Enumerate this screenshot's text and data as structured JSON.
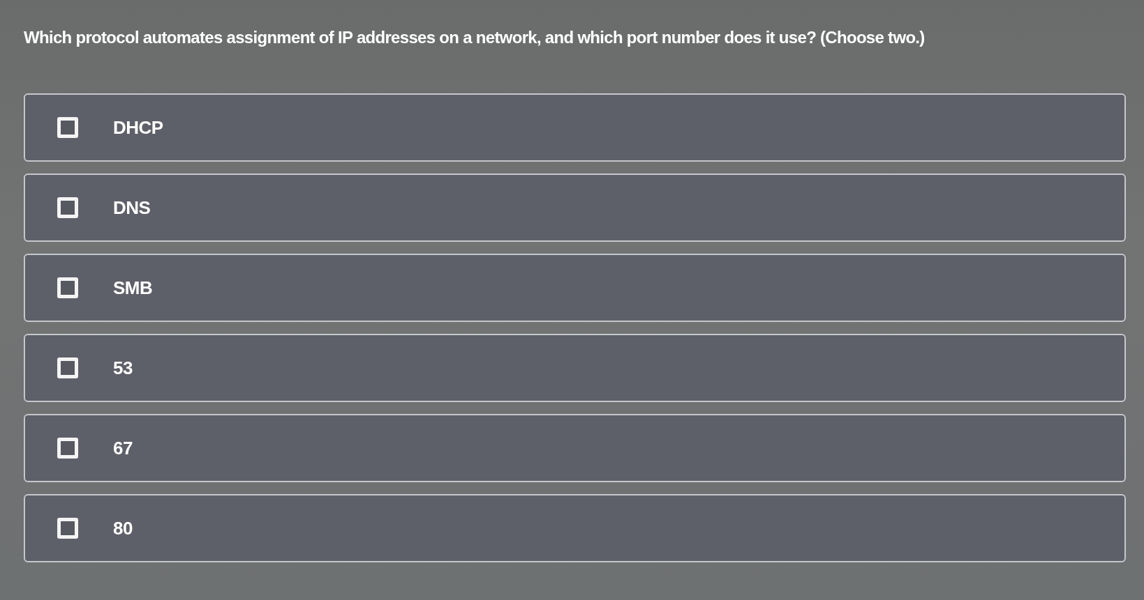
{
  "question": "Which protocol automates assignment of IP addresses on a network, and which port number does it use? (Choose two.)",
  "options": [
    {
      "label": "DHCP",
      "checked": false
    },
    {
      "label": "DNS",
      "checked": false
    },
    {
      "label": "SMB",
      "checked": false
    },
    {
      "label": "53",
      "checked": false
    },
    {
      "label": "67",
      "checked": false
    },
    {
      "label": "80",
      "checked": false
    }
  ]
}
